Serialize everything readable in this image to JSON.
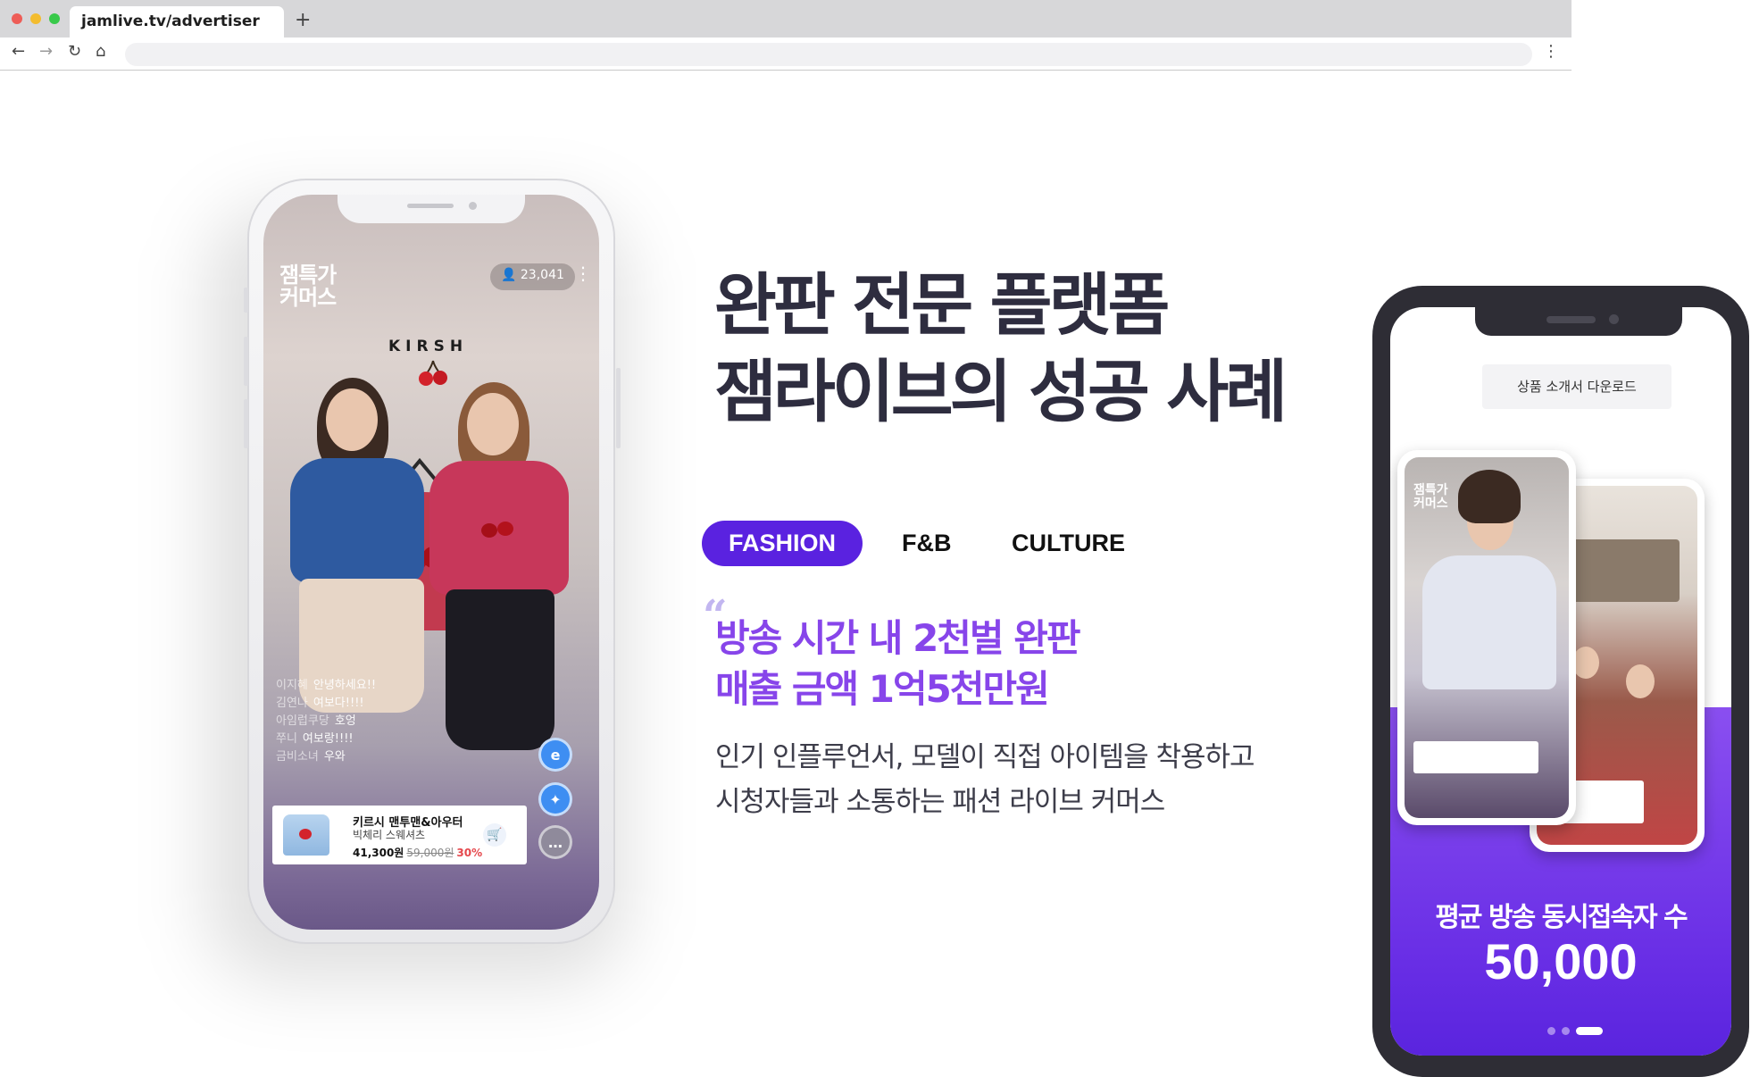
{
  "browser": {
    "tab_title": "jamlive.tv/advertiser",
    "new_tab_label": "+",
    "icons": [
      "back-icon",
      "forward-icon",
      "reload-icon",
      "home-icon",
      "menu-icon"
    ]
  },
  "left_phone": {
    "brand_logo": "잼특가 커머스",
    "viewer_count": "23,041",
    "brand_name": "KIRSH",
    "chat": [
      {
        "nick": "이지혜",
        "msg": "안녕하세요!!"
      },
      {
        "nick": "김연나",
        "msg": "여보다!!!!"
      },
      {
        "nick": "아임럽쿠당",
        "msg": "호엉"
      },
      {
        "nick": "쭈니",
        "msg": "여보랑!!!!"
      },
      {
        "nick": "금비소녀",
        "msg": "우와"
      }
    ],
    "product": {
      "title": "키르시 맨투맨&아우터",
      "subtitle": "빅체리 스웨셔츠",
      "price": "41,300원",
      "original_price": "59,000원",
      "discount": "30%"
    }
  },
  "headline": {
    "line1": "완판 전문 플랫폼",
    "line2": "잼라이브의 성공 사례"
  },
  "category_tabs": [
    {
      "label": "FASHION",
      "active": true
    },
    {
      "label": "F&B",
      "active": false
    },
    {
      "label": "CULTURE",
      "active": false
    }
  ],
  "case": {
    "quote_mark": "“",
    "highlight_line1": "방송 시간 내 2천벌 완판",
    "highlight_line2": "매출 금액 1억5천만원",
    "desc_line1": "인기 인플루언서, 모델이 직접 아이템을 착용하고",
    "desc_line2": "시청자들과 소통하는 패션 라이브 커머스"
  },
  "right_phone": {
    "download_button": "상품 소개서 다운로드",
    "stat_label": "평균 방송 동시접속자 수",
    "stat_value": "50,000",
    "pager_active_index": 2,
    "pager_count": 3
  },
  "colors": {
    "accent": "#5a22e0",
    "highlight": "#8745ea",
    "headline": "#2e2d3f",
    "phone_dark": "#2e2d35"
  }
}
